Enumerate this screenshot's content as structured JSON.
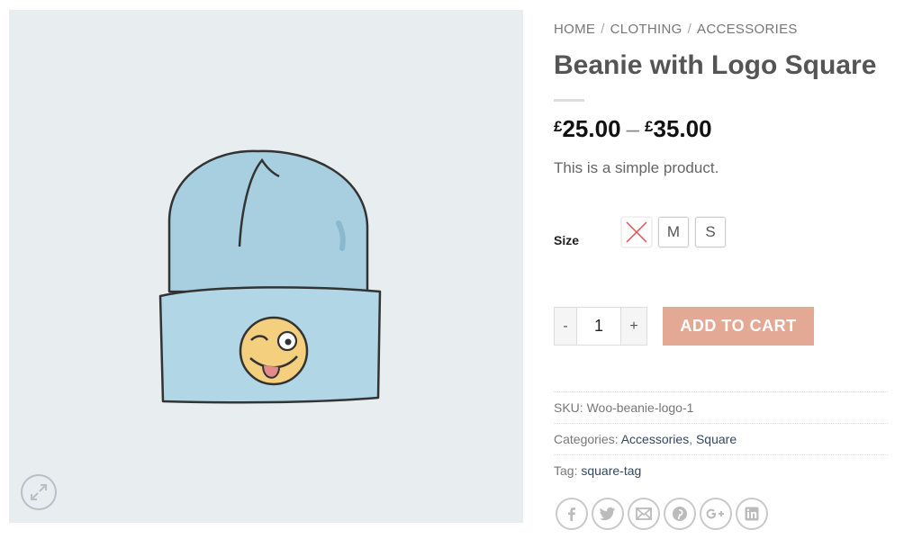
{
  "breadcrumb": {
    "home": "HOME",
    "category": "CLOTHING",
    "subcategory": "ACCESSORIES",
    "separator": "/"
  },
  "product": {
    "title": "Beanie with Logo Square",
    "price_currency": "£",
    "price_min": "25.00",
    "price_max": "35.00",
    "price_dash": "–",
    "description": "This is a simple product."
  },
  "variations": {
    "size_label": "Size",
    "options": [
      {
        "label": "",
        "available": false
      },
      {
        "label": "M",
        "available": true
      },
      {
        "label": "S",
        "available": true
      }
    ]
  },
  "cart": {
    "minus": "-",
    "quantity": "1",
    "plus": "+",
    "add_to_cart": "ADD TO CART"
  },
  "meta": {
    "sku_label": "SKU:",
    "sku_value": "Woo-beanie-logo-1",
    "categories_label": "Categories:",
    "category_1": "Accessories",
    "category_sep": ",",
    "category_2": "Square",
    "tag_label": "Tag:",
    "tag_value": "square-tag"
  },
  "share": [
    "facebook-icon",
    "twitter-icon",
    "email-icon",
    "pinterest-icon",
    "google-plus-icon",
    "linkedin-icon"
  ],
  "colors": {
    "accent_button": "#e3a994",
    "link": "#334862",
    "image_bg": "#e8edf0",
    "beanie": "#a8cfe0"
  }
}
